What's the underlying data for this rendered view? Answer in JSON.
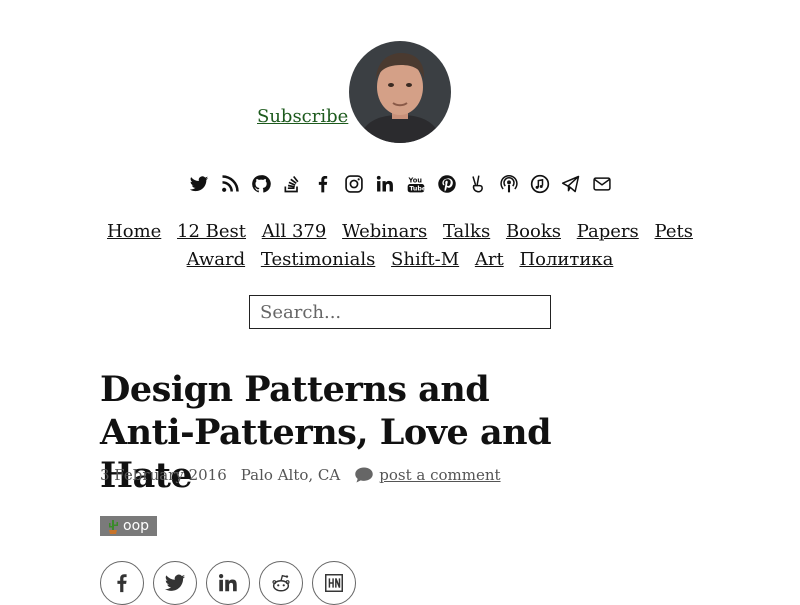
{
  "header": {
    "subscribe_label": "Subscribe",
    "avatar_icon": "author-portrait"
  },
  "social_icons": [
    "twitter-icon",
    "rss-icon",
    "github-icon",
    "stackoverflow-icon",
    "facebook-icon",
    "instagram-icon",
    "linkedin-icon",
    "youtube-icon",
    "pinterest-icon",
    "peace-icon",
    "podcast-icon",
    "music-icon",
    "telegram-icon",
    "email-icon"
  ],
  "nav": {
    "row1": [
      "Home",
      "12 Best",
      "All 379",
      "Webinars",
      "Talks",
      "Books",
      "Papers",
      "Pets"
    ],
    "row2": [
      "Award",
      "Testimonials",
      "Shift-M",
      "Art",
      "Политика"
    ]
  },
  "search": {
    "placeholder": "Search..."
  },
  "article": {
    "title": "Design Patterns and Anti-Patterns, Love and Hate",
    "date": "3 February 2016",
    "location": "Palo Alto, CA",
    "comment_link": "post a comment",
    "tag": "oop"
  },
  "share": [
    "facebook-share-icon",
    "twitter-share-icon",
    "linkedin-share-icon",
    "reddit-share-icon",
    "hackernews-share-icon"
  ],
  "colors": {
    "subscribe": "#1d5a1d",
    "tag_bg": "#7a7a7a",
    "text": "#111111"
  }
}
